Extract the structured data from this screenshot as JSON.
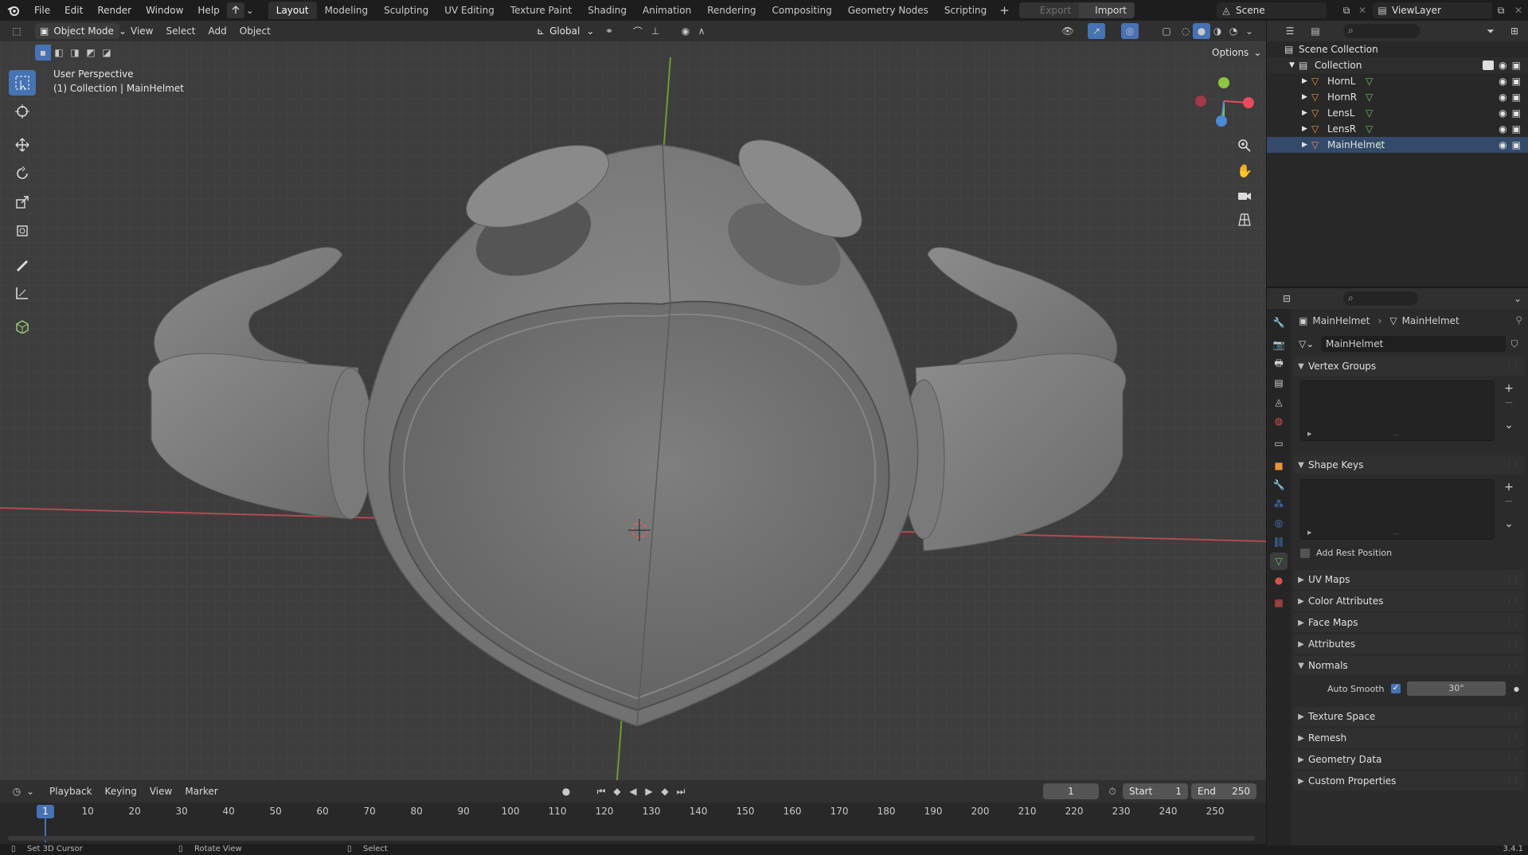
{
  "topbar": {
    "menus": [
      "File",
      "Edit",
      "Render",
      "Window",
      "Help"
    ],
    "workspaces": [
      "Layout",
      "Modeling",
      "Sculpting",
      "UV Editing",
      "Texture Paint",
      "Shading",
      "Animation",
      "Rendering",
      "Compositing",
      "Geometry Nodes",
      "Scripting"
    ],
    "active_workspace": "Layout",
    "export_label": "Export",
    "import_label": "Import",
    "scene_name": "Scene",
    "view_layer": "ViewLayer"
  },
  "viewport_header": {
    "mode": "Object Mode",
    "menus": [
      "View",
      "Select",
      "Add",
      "Object"
    ],
    "transform_orientation": "Global",
    "options_label": "Options"
  },
  "viewport": {
    "view_name": "User Perspective",
    "context": "(1) Collection | MainHelmet"
  },
  "outliner": {
    "root": "Scene Collection",
    "collection": "Collection",
    "objects": [
      "HornL",
      "HornR",
      "LensL",
      "LensR",
      "MainHelmet"
    ],
    "colors": {
      "object_icon": "#e8943a",
      "mesh_icon": "#6ec36a"
    }
  },
  "properties": {
    "breadcrumb_object": "MainHelmet",
    "breadcrumb_mesh": "MainHelmet",
    "mesh_name": "MainHelmet",
    "panels": {
      "vertex_groups": "Vertex Groups",
      "shape_keys": "Shape Keys",
      "add_rest_position": "Add Rest Position",
      "uv_maps": "UV Maps",
      "color_attributes": "Color Attributes",
      "face_maps": "Face Maps",
      "attributes": "Attributes",
      "normals": "Normals",
      "auto_smooth": "Auto Smooth",
      "auto_smooth_angle": "30°",
      "texture_space": "Texture Space",
      "remesh": "Remesh",
      "geometry_data": "Geometry Data",
      "custom_properties": "Custom Properties"
    }
  },
  "timeline": {
    "menus": [
      "Playback",
      "Keying",
      "View",
      "Marker"
    ],
    "current_frame": "1",
    "start_label": "Start",
    "start_value": "1",
    "end_label": "End",
    "end_value": "250",
    "ticks": [
      "1",
      "10",
      "20",
      "30",
      "40",
      "50",
      "60",
      "70",
      "80",
      "90",
      "100",
      "110",
      "120",
      "130",
      "140",
      "150",
      "160",
      "170",
      "180",
      "190",
      "200",
      "210",
      "220",
      "230",
      "240",
      "250"
    ]
  },
  "statusbar": {
    "items": [
      "Set 3D Cursor",
      "Rotate View",
      "Select"
    ],
    "version": "3.4.1"
  },
  "colors": {
    "accent": "#4772b3",
    "x_axis": "#e84a5f",
    "y_axis": "#8ec63f",
    "z_axis": "#4b8ad6"
  }
}
